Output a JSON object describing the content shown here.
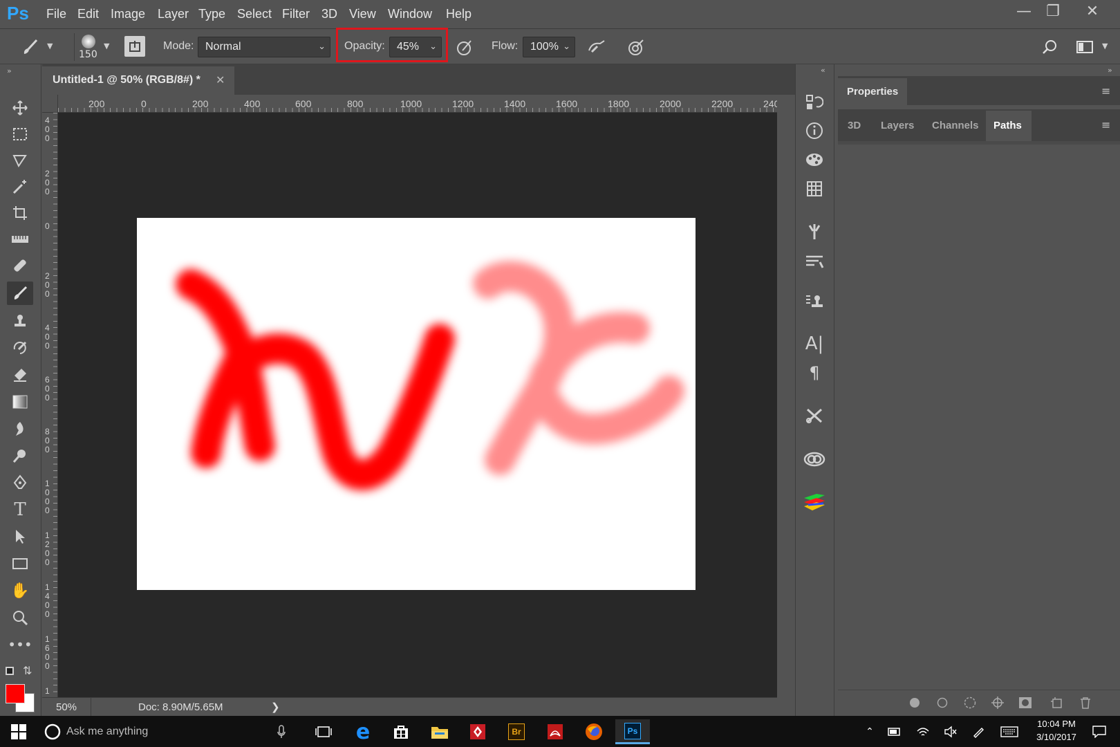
{
  "app": {
    "logo": "Ps",
    "title": "Untitled-1 @ 50% (RGB/8#) *"
  },
  "menu": [
    "File",
    "Edit",
    "Image",
    "Layer",
    "Type",
    "Select",
    "Filter",
    "3D",
    "View",
    "Window",
    "Help"
  ],
  "options": {
    "brush_size": "150",
    "mode_label": "Mode:",
    "mode_value": "Normal",
    "opacity_label": "Opacity:",
    "opacity_value": "45%",
    "flow_label": "Flow:",
    "flow_value": "100%"
  },
  "ruler": {
    "h_ticks": [
      "200",
      "0",
      "200",
      "400",
      "600",
      "800",
      "1000",
      "1200",
      "1400",
      "1600",
      "1800",
      "2000",
      "2200",
      "240"
    ],
    "v_ticks": [
      "4\n0\n0",
      "2\n0\n0",
      "0",
      "2\n0\n0",
      "4\n0\n0",
      "6\n0\n0",
      "8\n0\n0",
      "1\n0\n0\n0",
      "1\n2\n0\n0",
      "1\n4\n0\n0",
      "1\n6\n0\n0",
      "1"
    ]
  },
  "status": {
    "zoom": "50%",
    "doc_size": "Doc: 8.90M/5.65M"
  },
  "panels": {
    "properties_title": "Properties",
    "tabs": [
      "3D",
      "Layers",
      "Channels",
      "Paths"
    ],
    "active_tab": "Paths"
  },
  "colors": {
    "foreground": "#ff0000",
    "background": "#ffffff",
    "accent": "#31a8ff",
    "highlight": "#e0161c"
  },
  "taskbar": {
    "search_placeholder": "Ask me anything",
    "time": "10:04 PM",
    "date": "3/10/2017",
    "apps": [
      "task-view",
      "edge",
      "store",
      "file-explorer",
      "app-red",
      "bridge",
      "acrobat",
      "firefox",
      "photoshop"
    ]
  }
}
